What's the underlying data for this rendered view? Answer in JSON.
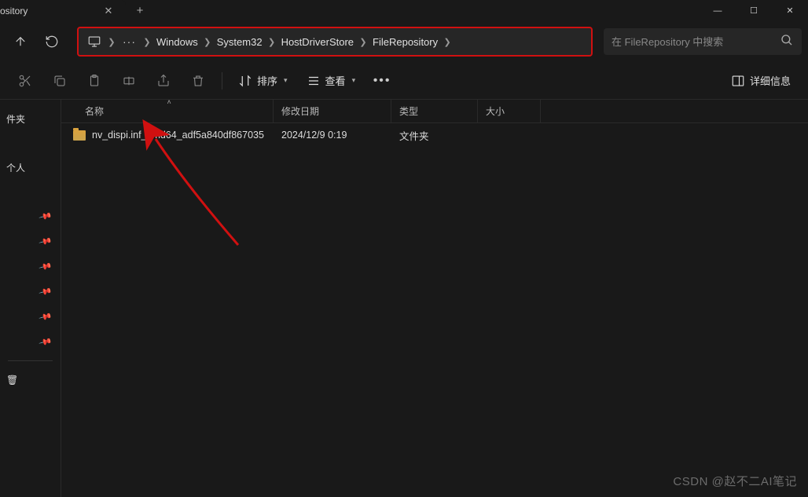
{
  "window": {
    "tab_title": "ository",
    "minimize": "—",
    "maximize": "☐",
    "close": "✕"
  },
  "breadcrumb": {
    "ellipsis": "···",
    "items": [
      "Windows",
      "System32",
      "HostDriverStore",
      "FileRepository"
    ]
  },
  "search": {
    "placeholder": "在 FileRepository 中搜索"
  },
  "toolbar": {
    "sort_label": "排序",
    "view_label": "查看",
    "details_label": "详细信息"
  },
  "sidebar": {
    "item1": "件夹",
    "item2": "个人",
    "recycle": "🗑"
  },
  "columns": {
    "name": "名称",
    "date": "修改日期",
    "type": "类型",
    "size": "大小"
  },
  "files": [
    {
      "name": "nv_dispi.inf_amd64_adf5a840df867035",
      "date": "2024/12/9 0:19",
      "type": "文件夹",
      "size": ""
    }
  ],
  "watermark": "CSDN @赵不二AI笔记"
}
